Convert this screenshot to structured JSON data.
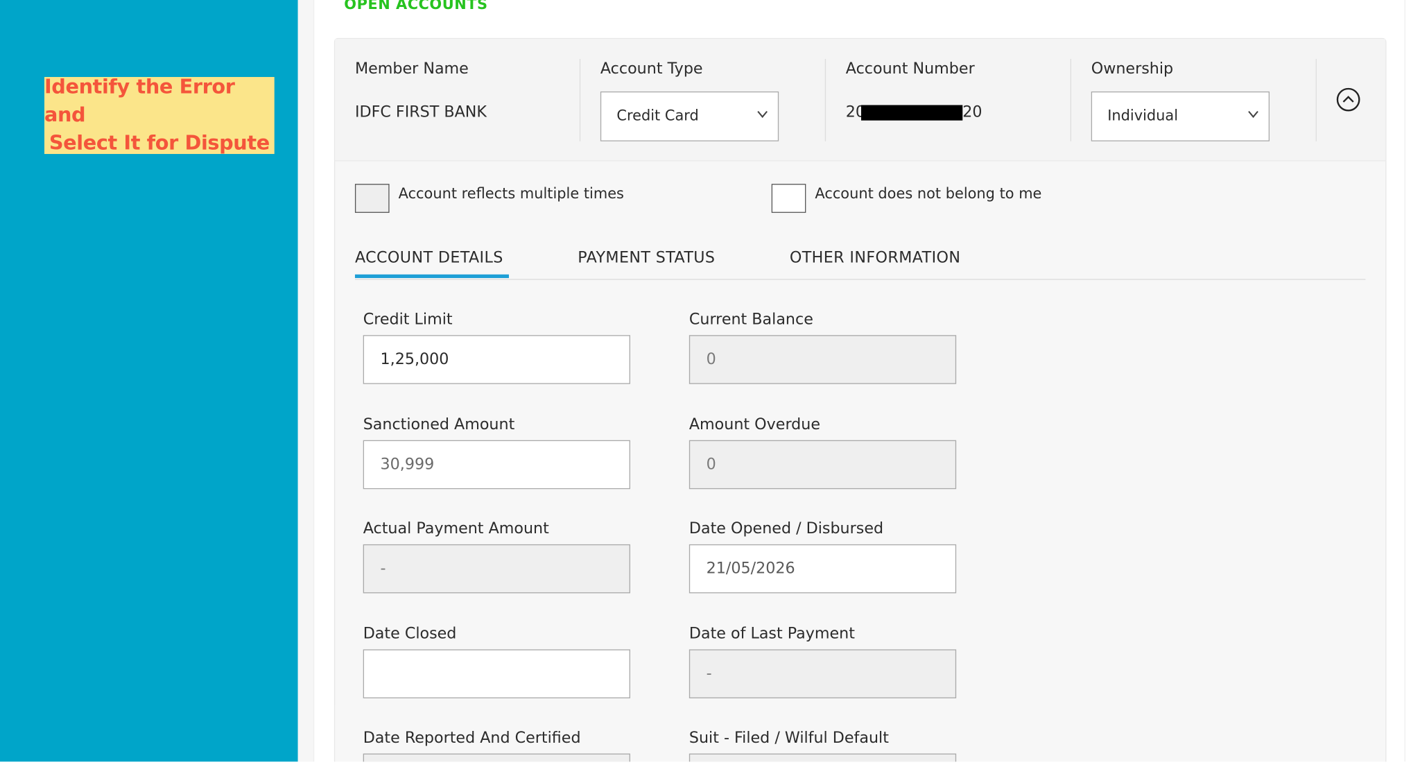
{
  "sidebar": {
    "hint_line1": "Identify the Error and",
    "hint_line2": "Select It for Dispute"
  },
  "section_title": "OPEN ACCOUNTS",
  "header": {
    "member_name_label": "Member Name",
    "member_name_value": "IDFC FIRST BANK",
    "account_type_label": "Account Type",
    "account_type_value": "Credit Card",
    "account_number_label": "Account Number",
    "account_number_prefix": "20",
    "account_number_suffix": "20",
    "ownership_label": "Ownership",
    "ownership_value": "Individual"
  },
  "checkboxes": {
    "multiple_times": "Account reflects multiple times",
    "not_belong": "Account does not belong to me"
  },
  "tabs": {
    "account_details": "ACCOUNT DETAILS",
    "payment_status": "PAYMENT STATUS",
    "other_information": "OTHER INFORMATION"
  },
  "fields": {
    "credit_limit_label": "Credit Limit",
    "credit_limit_value": "1,25,000",
    "current_balance_label": "Current Balance",
    "current_balance_value": "0",
    "sanctioned_amount_label": "Sanctioned Amount",
    "sanctioned_amount_value": "30,999",
    "amount_overdue_label": "Amount Overdue",
    "amount_overdue_value": "0",
    "actual_payment_label": "Actual Payment Amount",
    "actual_payment_value": "-",
    "date_opened_label": "Date Opened / Disbursed",
    "date_opened_value": "21/05/2026",
    "date_closed_label": "Date Closed",
    "date_closed_value": "",
    "date_last_payment_label": "Date of Last Payment",
    "date_last_payment_value": "-",
    "date_reported_label": "Date Reported And Certified",
    "suit_filed_label": "Suit - Filed / Wilful Default"
  },
  "colors": {
    "sidebar": "#00a5c9",
    "hint_bg": "#fbe58a",
    "hint_text": "#f4553b",
    "section_title": "#27c31f",
    "tab_active_underline": "#1e9fd6"
  }
}
